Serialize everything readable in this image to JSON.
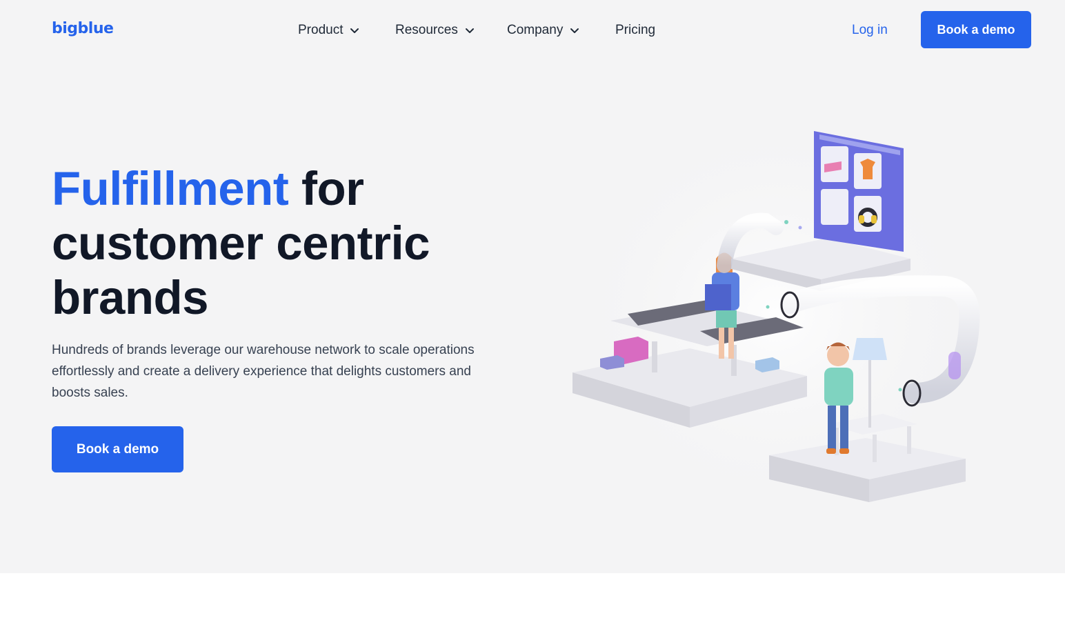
{
  "header": {
    "logo_text": "bigblue",
    "nav": [
      {
        "label": "Product",
        "has_dropdown": true
      },
      {
        "label": "Resources",
        "has_dropdown": true
      },
      {
        "label": "Company",
        "has_dropdown": true
      },
      {
        "label": "Pricing",
        "has_dropdown": false
      }
    ],
    "login_label": "Log in",
    "cta_label": "Book a demo"
  },
  "hero": {
    "headline_accent": "Fulfillment",
    "headline_rest_1": " for",
    "headline_rest_2": "customer centric",
    "headline_rest_3": "brands",
    "subtext": "Hundreds of brands leverage our warehouse network to scale operations effortlessly and create a delivery experience that delights customers and boosts sales.",
    "cta_label": "Book a demo"
  },
  "colors": {
    "brand_blue": "#2563eb",
    "hero_background": "#f4f4f5",
    "heading_text": "#111827",
    "body_text": "#374151"
  },
  "icons": [
    "chevron-down-icon",
    "warehouse-illustration"
  ]
}
